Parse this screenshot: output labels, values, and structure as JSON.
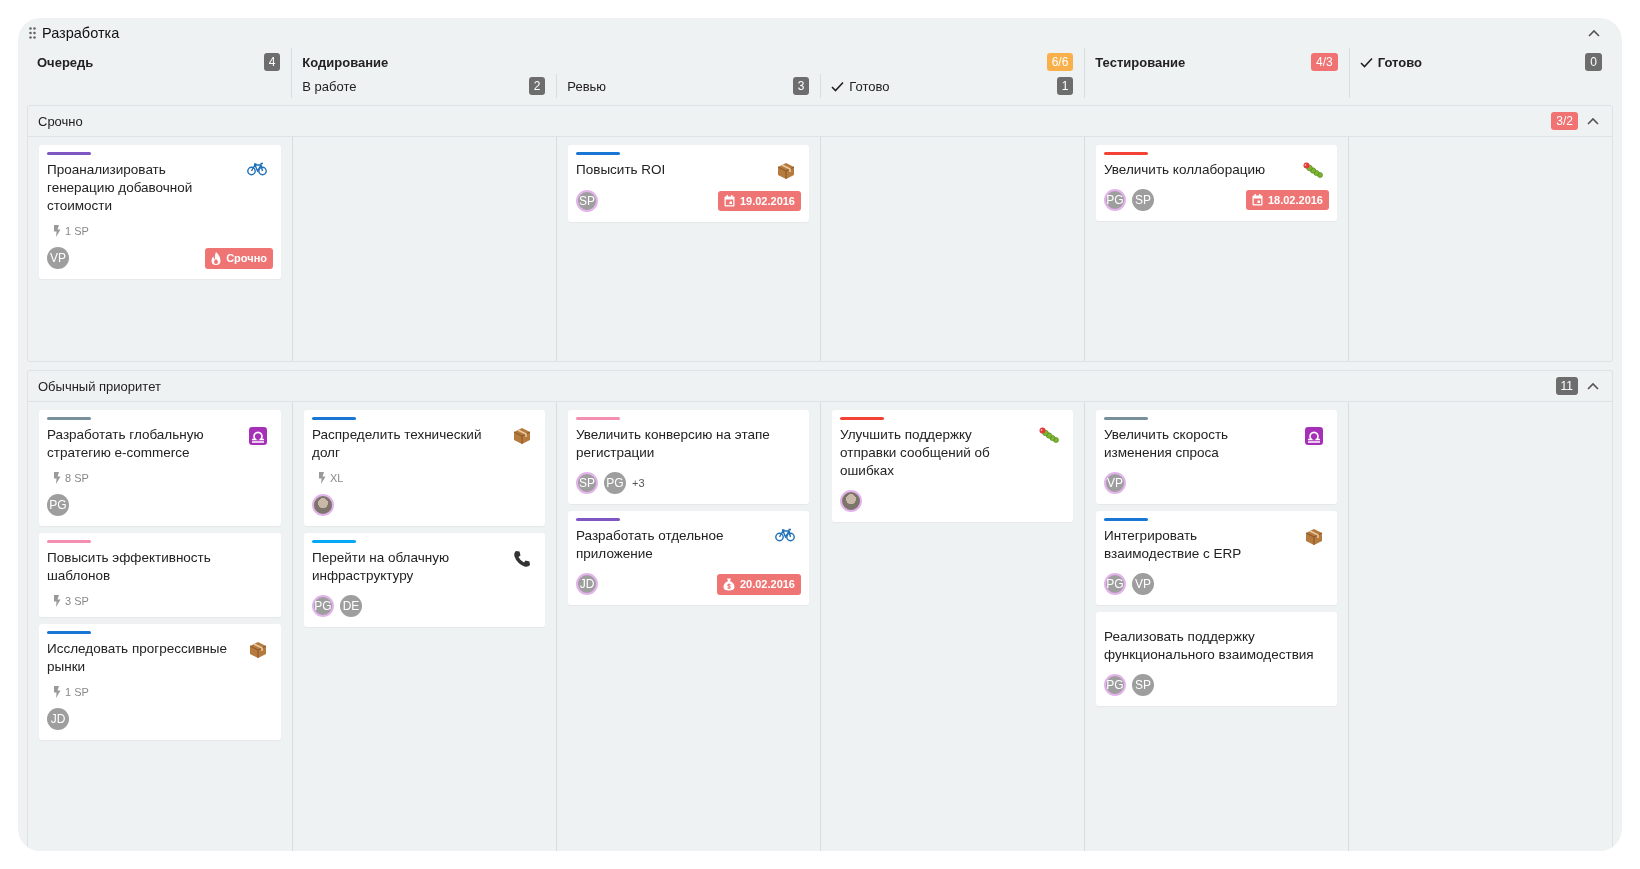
{
  "board": {
    "title": "Разработка",
    "expanded": true
  },
  "columns": [
    {
      "title": "Очередь",
      "badge": {
        "text": "4",
        "color": "#6d6d6d"
      },
      "done": false
    },
    {
      "title": "Кодирование",
      "badge": {
        "text": "6/6",
        "color": "#f9b04a"
      },
      "done": false,
      "children": [
        {
          "title": "В работе",
          "badge": {
            "text": "2",
            "color": "#6d6d6d"
          },
          "done": false
        },
        {
          "title": "Ревью",
          "badge": {
            "text": "3",
            "color": "#6d6d6d"
          },
          "done": false
        },
        {
          "title": "Готово",
          "badge": {
            "text": "1",
            "color": "#6d6d6d"
          },
          "done": true
        }
      ]
    },
    {
      "title": "Тестирование",
      "badge": {
        "text": "4/3",
        "color": "#f07272"
      },
      "done": false
    },
    {
      "title": "Готово",
      "badge": {
        "text": "0",
        "color": "#6d6d6d"
      },
      "done": true
    }
  ],
  "lanes": [
    {
      "title": "Срочно",
      "badge": {
        "text": "3/2",
        "color": "#f07272"
      },
      "expanded": true,
      "cells": [
        [
          {
            "title": "Проанализировать генерацию добавочной стоимости",
            "color": "#7e57c2",
            "kind": "bicycle",
            "points": "1 SP",
            "avatars": [
              {
                "kind": "initials",
                "initials": "VP",
                "ring": false
              }
            ],
            "badge": {
              "kind": "urgent",
              "text": "Срочно"
            }
          }
        ],
        null,
        [
          {
            "title": "Повысить ROI",
            "color": "#1976d2",
            "kind": "package",
            "avatars": [
              {
                "kind": "initials",
                "initials": "SP",
                "ring": true
              }
            ],
            "badge": {
              "kind": "calendar",
              "text": "19.02.2016"
            }
          }
        ],
        null,
        [
          {
            "title": "Увеличить коллаборацию",
            "color": "#f44336",
            "kind": "caterpillar",
            "avatars": [
              {
                "kind": "initials",
                "initials": "PG",
                "ring": true
              },
              {
                "kind": "initials",
                "initials": "SP",
                "ring": false
              }
            ],
            "badge": {
              "kind": "calendar",
              "text": "18.02.2016"
            }
          }
        ],
        null
      ]
    },
    {
      "title": "Обычный приоритет",
      "badge": {
        "text": "11",
        "color": "#6d6d6d"
      },
      "expanded": true,
      "cells": [
        [
          {
            "title": "Разработать глобальную стратегию e-commerce",
            "color": "#78909c",
            "kind": "libra",
            "points": "8 SP",
            "avatars": [
              {
                "kind": "initials",
                "initials": "PG",
                "ring": false
              }
            ]
          },
          {
            "title": "Повысить эффективность шаблонов",
            "color": "#f48fb1",
            "points": "3 SP"
          },
          {
            "title": "Исследовать прогрессивные рынки",
            "color": "#1976d2",
            "kind": "package",
            "points": "1 SP",
            "avatars": [
              {
                "kind": "initials",
                "initials": "JD",
                "ring": false
              }
            ]
          }
        ],
        [
          {
            "title": "Распределить технический долг",
            "color": "#1976d2",
            "kind": "package",
            "points": "XL",
            "avatars": [
              {
                "kind": "photo",
                "ring": true
              }
            ]
          },
          {
            "title": "Перейти на облачную инфраструктуру",
            "color": "#03a9f4",
            "kind": "phone",
            "avatars": [
              {
                "kind": "initials",
                "initials": "PG",
                "ring": true
              },
              {
                "kind": "initials",
                "initials": "DE",
                "ring": false
              }
            ]
          }
        ],
        [
          {
            "title": "Увеличить конверсию на этапе регистрации",
            "color": "#f48fb1",
            "avatars": [
              {
                "kind": "initials",
                "initials": "SP",
                "ring": true
              },
              {
                "kind": "initials",
                "initials": "PG",
                "ring": false
              }
            ],
            "more": "+3"
          },
          {
            "title": "Разработать отдельное приложение",
            "color": "#7e57c2",
            "kind": "bicycle",
            "avatars": [
              {
                "kind": "initials",
                "initials": "JD",
                "ring": true
              }
            ],
            "badge": {
              "kind": "money",
              "text": "20.02.2016"
            }
          }
        ],
        [
          {
            "title": "Улучшить поддержку отправки сообщений об ошибках",
            "color": "#f44336",
            "kind": "caterpillar",
            "avatars": [
              {
                "kind": "photo",
                "ring": true
              }
            ]
          }
        ],
        [
          {
            "title": "Увеличить скорость изменения спроса",
            "color": "#78909c",
            "kind": "libra",
            "avatars": [
              {
                "kind": "initials",
                "initials": "VP",
                "ring": true
              }
            ]
          },
          {
            "title": "Интегрировать взаимодествие с ERP",
            "color": "#1976d2",
            "kind": "package",
            "avatars": [
              {
                "kind": "initials",
                "initials": "PG",
                "ring": true
              },
              {
                "kind": "initials",
                "initials": "VP",
                "ring": false
              }
            ]
          },
          {
            "title": "Реализовать поддержку функционального взаимодествия",
            "avatars": [
              {
                "kind": "initials",
                "initials": "PG",
                "ring": true
              },
              {
                "kind": "initials",
                "initials": "SP",
                "ring": false
              }
            ]
          }
        ],
        null
      ]
    }
  ]
}
